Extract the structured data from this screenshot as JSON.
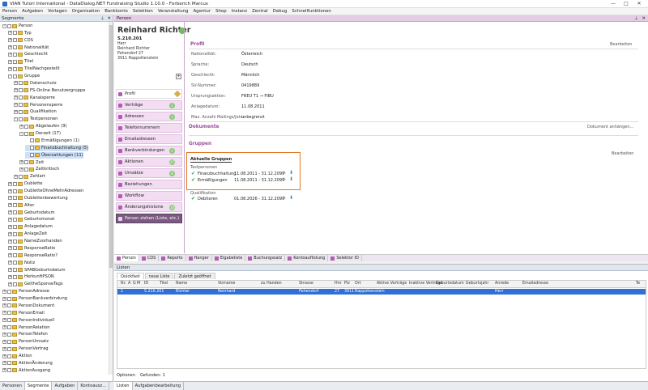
{
  "window": {
    "title": "VIAN Tutori International - DataDialog.NET Fundraising Studio 1.10.0 - Forberich Marcus",
    "minimize": "—",
    "maximize": "□",
    "close": "✕"
  },
  "menu": [
    "Person",
    "Aufgaben",
    "Vorlagen",
    "Organisation",
    "Bankkonto",
    "Selektion",
    "Veranstaltung",
    "Agentur",
    "Shop",
    "Instanz",
    "Zentral",
    "Debug",
    "Schnellfunktionen"
  ],
  "segmente": {
    "title": "Segmente",
    "pin": "⊥",
    "close": "✕"
  },
  "tree": [
    {
      "label": "Person",
      "indent": 0,
      "exp": "-",
      "chk": true
    },
    {
      "label": "Typ",
      "indent": 1,
      "exp": "+",
      "chk": true
    },
    {
      "label": "CDS",
      "indent": 1,
      "exp": "+",
      "chk": true
    },
    {
      "label": "Nationalität",
      "indent": 1,
      "exp": "+",
      "chk": true
    },
    {
      "label": "Geschlecht",
      "indent": 1,
      "exp": "+",
      "chk": true
    },
    {
      "label": "Titel",
      "indent": 1,
      "exp": "+",
      "chk": true
    },
    {
      "label": "TitelNachgestellt",
      "indent": 1,
      "exp": "+",
      "chk": true
    },
    {
      "label": "Gruppe",
      "indent": 1,
      "exp": "-",
      "chk": true
    },
    {
      "label": "Datenschutz",
      "indent": 2,
      "exp": "+",
      "chk": true
    },
    {
      "label": "FS-Online Benutzergruppe",
      "indent": 2,
      "exp": "+",
      "chk": true
    },
    {
      "label": "Kanalsperre",
      "indent": 2,
      "exp": "+",
      "chk": true
    },
    {
      "label": "Personensperre",
      "indent": 2,
      "exp": "+",
      "chk": true
    },
    {
      "label": "Qualifikation",
      "indent": 2,
      "exp": "+",
      "chk": true
    },
    {
      "label": "Testpersonen",
      "indent": 2,
      "exp": "-",
      "chk": true
    },
    {
      "label": "Abgelaufen (9)",
      "indent": 3,
      "exp": "+",
      "chk": true
    },
    {
      "label": "Derzeit (17)",
      "indent": 3,
      "exp": "-",
      "chk": true
    },
    {
      "label": "Ermäßigungen (1)",
      "indent": 4,
      "exp": "",
      "chk": true
    },
    {
      "label": "Finanzbuchhaltung (5)",
      "indent": 4,
      "exp": "",
      "chk": true,
      "sel": true
    },
    {
      "label": "Überzahlungen (11)",
      "indent": 4,
      "exp": "",
      "chk": true,
      "sel": true
    },
    {
      "label": "Zeit",
      "indent": 3,
      "exp": "+",
      "chk": true
    },
    {
      "label": "Zeitkritisch",
      "indent": 3,
      "exp": "+",
      "chk": true
    },
    {
      "label": "Zehlart",
      "indent": 2,
      "exp": "+",
      "chk": true
    },
    {
      "label": "Dublette",
      "indent": 1,
      "exp": "+",
      "chk": true
    },
    {
      "label": "DubletteOhneMehrAdressen",
      "indent": 1,
      "exp": "+",
      "chk": true
    },
    {
      "label": "Dublettenbewertung",
      "indent": 1,
      "exp": "+",
      "chk": true
    },
    {
      "label": "Alter",
      "indent": 1,
      "exp": "+",
      "chk": true
    },
    {
      "label": "Geburtsdatum",
      "indent": 1,
      "exp": "+",
      "chk": true
    },
    {
      "label": "Geburtsmonat",
      "indent": 1,
      "exp": "+",
      "chk": true
    },
    {
      "label": "Anlagedatum",
      "indent": 1,
      "exp": "+",
      "chk": true
    },
    {
      "label": "AnlageZeit",
      "indent": 1,
      "exp": "+",
      "chk": true
    },
    {
      "label": "NameZvorhanden",
      "indent": 1,
      "exp": "+",
      "chk": true
    },
    {
      "label": "ResponseRatio",
      "indent": 1,
      "exp": "+",
      "chk": true
    },
    {
      "label": "ResponseRatio?",
      "indent": 1,
      "exp": "+",
      "chk": true
    },
    {
      "label": "Notiz",
      "indent": 1,
      "exp": "+",
      "chk": true
    },
    {
      "label": "SPABGeburtsdatum",
      "indent": 1,
      "exp": "+",
      "chk": true
    },
    {
      "label": "HerkunftPSON",
      "indent": 1,
      "exp": "+",
      "chk": true
    },
    {
      "label": "GeltheSponseTags",
      "indent": 1,
      "exp": "+",
      "chk": true
    },
    {
      "label": "PersonAdresse",
      "indent": 0,
      "exp": "+",
      "chk": true
    },
    {
      "label": "PersonBankverbindung",
      "indent": 0,
      "exp": "+",
      "chk": true
    },
    {
      "label": "PersonDokument",
      "indent": 0,
      "exp": "+",
      "chk": true
    },
    {
      "label": "PersonEmail",
      "indent": 0,
      "exp": "+",
      "chk": true
    },
    {
      "label": "PersonIndividuell",
      "indent": 0,
      "exp": "+",
      "chk": true
    },
    {
      "label": "PersonRelation",
      "indent": 0,
      "exp": "+",
      "chk": true
    },
    {
      "label": "PersonTelefon",
      "indent": 0,
      "exp": "+",
      "chk": true
    },
    {
      "label": "PersonUmsatz",
      "indent": 0,
      "exp": "+",
      "chk": true
    },
    {
      "label": "PersonVertrag",
      "indent": 0,
      "exp": "+",
      "chk": true
    },
    {
      "label": "Aktion",
      "indent": 0,
      "exp": "+",
      "chk": true
    },
    {
      "label": "AktionÄnderung",
      "indent": 0,
      "exp": "+",
      "chk": true
    },
    {
      "label": "AktionAusgang",
      "indent": 0,
      "exp": "+",
      "chk": true
    }
  ],
  "left_tabs": [
    "Personen",
    "Segmente",
    "Aufgaben",
    "Kontoausz..."
  ],
  "person": {
    "panel_title": "Person",
    "name": "Reinhard Richter",
    "number": "5.210.201",
    "address": [
      "Herr",
      "Reinhard Richter",
      "Pehendorf 27",
      "3911 Rappottenstein"
    ],
    "nav": [
      {
        "label": "Profil",
        "badge": ""
      },
      {
        "label": "Verträge",
        "badge": "1"
      },
      {
        "label": "Adressen",
        "badge": "1"
      },
      {
        "label": "Telefonnummern",
        "badge": ""
      },
      {
        "label": "Emailadressen",
        "badge": ""
      },
      {
        "label": "Bankverbindungen",
        "badge": "1"
      },
      {
        "label": "Aktionen",
        "badge": "27"
      },
      {
        "label": "Umsätze",
        "badge": "8"
      },
      {
        "label": "Beziehungen",
        "badge": ""
      },
      {
        "label": "Workflow",
        "badge": ""
      },
      {
        "label": "Änderungshistorie",
        "badge": "10"
      },
      {
        "label": "Person ziehen (Liste, etc.)",
        "badge": ""
      }
    ],
    "profil": {
      "title": "Profil",
      "edit": "Bearbeiten",
      "rows": [
        [
          "Nationalität:",
          "Österreich"
        ],
        [
          "Sprache:",
          "Deutsch"
        ],
        [
          "Geschlecht:",
          "Männlich"
        ],
        [
          "SV-Nummer:",
          "0419889"
        ],
        [
          "Ursprungsaktion:",
          "FREU T1 → FIBU"
        ],
        [
          "Anlagedatum:",
          "11.08.2011"
        ],
        [
          "Max. Anzahl Mailings/Jahr:",
          "unbegrenzt"
        ]
      ]
    },
    "dokumente": {
      "title": "Dokumente",
      "add": "Dokument anhängen..."
    },
    "gruppen": {
      "title": "Gruppen",
      "edit": "Bearbeiten",
      "current_title": "Aktuelle Gruppen",
      "cat1": "Testpersonen",
      "items1": [
        [
          "Finanzbuchhaltung",
          "11.08.2011 - 31.12.2099"
        ],
        [
          "Ermäßigungen",
          "11.08.2011 - 31.12.2099"
        ]
      ],
      "cat2": "Qualifikation",
      "items2": [
        [
          "Debitoren",
          "01.08.2026 - 31.12.2099"
        ]
      ]
    }
  },
  "person_tabs": [
    "Person",
    "CDS",
    "Reports",
    "Hanger",
    "Eigabeliste",
    "Buchungssatz",
    "Kontoauflistung",
    "Selektor ID"
  ],
  "listen": {
    "title": "Listen",
    "tabs": [
      "Quickfast",
      "neue Liste",
      "Zuletzt geöffnet"
    ],
    "columns": [
      "Nr.",
      "A",
      "G",
      "M",
      "ID",
      "Titel",
      "Name",
      "Vorname",
      "zu Handen",
      "Strasse",
      "Hnr",
      "Plz",
      "Ort",
      "Aktive Verträge",
      "Inaktive Verträge",
      "Geburtsdatum",
      "Geburtsjahr",
      "Anrede",
      "Emailadresse",
      "Te"
    ],
    "row": [
      "1",
      "",
      "",
      "",
      "5.210.201",
      "",
      "Richter",
      "Reinhard",
      "",
      "Pehendorf",
      "27",
      "3911",
      "Rappottenstein",
      "",
      "",
      "",
      "",
      "Herr",
      "",
      ""
    ],
    "footer": [
      "Optionen",
      "Gefunden: 1"
    ]
  },
  "bottom_tabs": [
    "Listen",
    "Aufgabenbearbeitung"
  ]
}
